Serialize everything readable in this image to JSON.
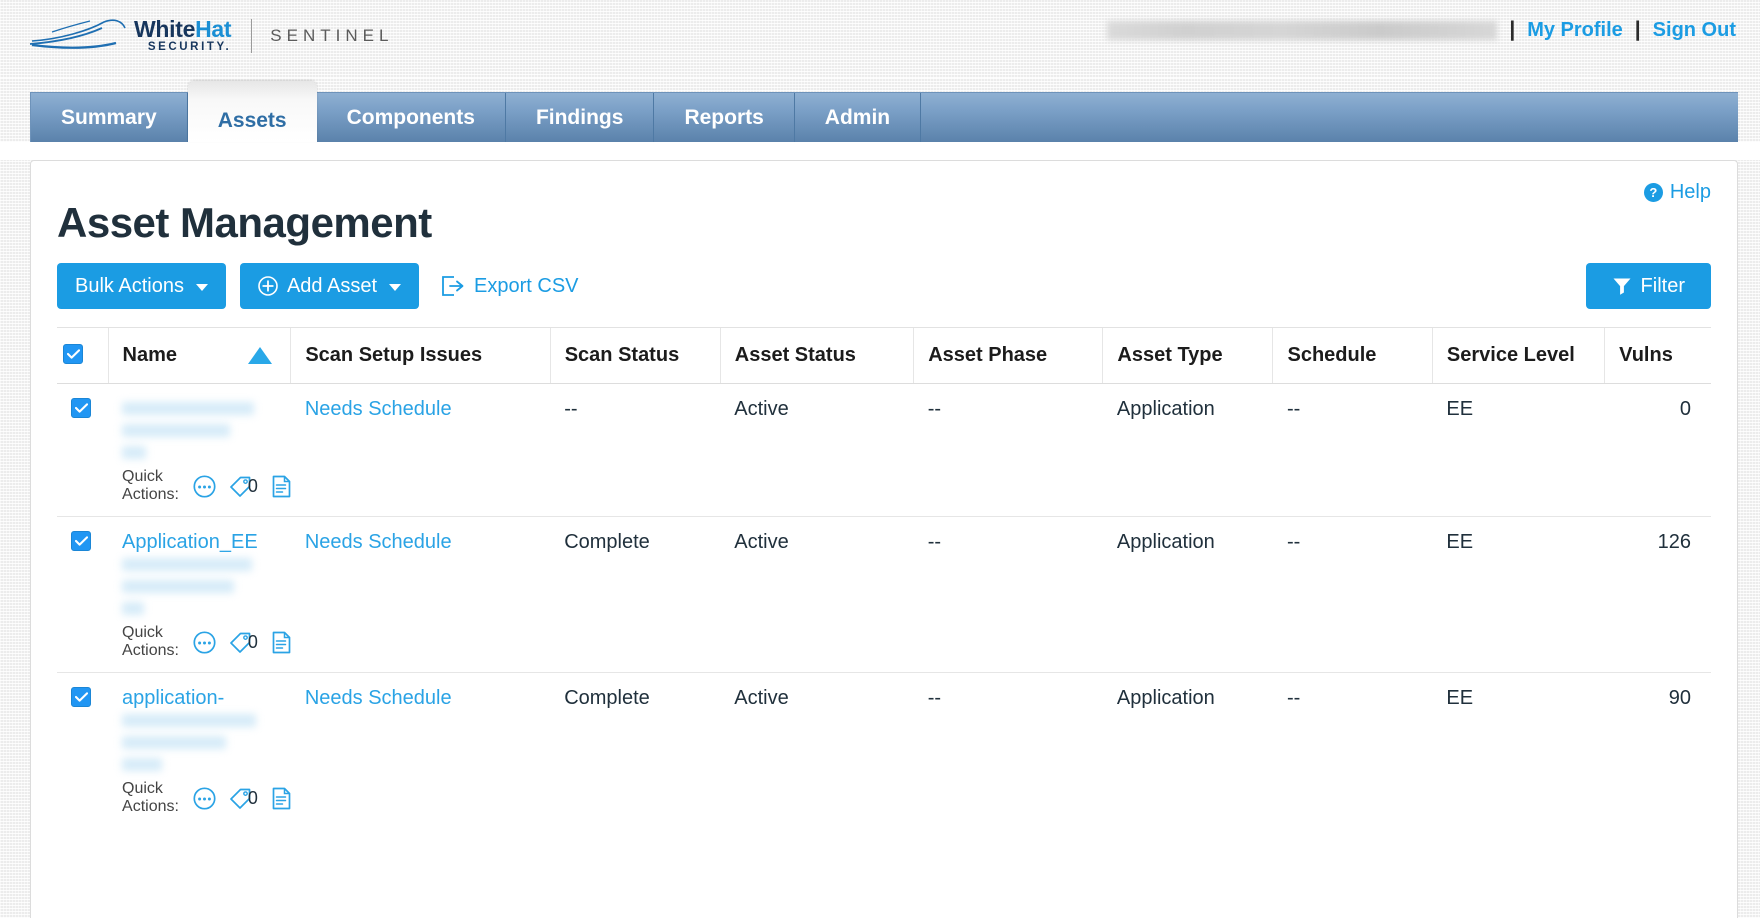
{
  "brand": {
    "name_white": "White",
    "name_hat": "Hat",
    "security": "SECURITY.",
    "product": "SENTINEL"
  },
  "header": {
    "user_account": "",
    "separator": "|",
    "my_profile": "My Profile",
    "sign_out": "Sign Out"
  },
  "nav": {
    "tabs": [
      {
        "label": "Summary",
        "active": false
      },
      {
        "label": "Assets",
        "active": true
      },
      {
        "label": "Components",
        "active": false
      },
      {
        "label": "Findings",
        "active": false
      },
      {
        "label": "Reports",
        "active": false
      },
      {
        "label": "Admin",
        "active": false
      }
    ]
  },
  "page": {
    "title": "Asset Management",
    "help_label": "Help",
    "help_badge": "?"
  },
  "toolbar": {
    "bulk_actions": "Bulk Actions",
    "add_asset": "Add Asset",
    "export_csv": "Export CSV",
    "filter": "Filter"
  },
  "table": {
    "columns": [
      "Name",
      "Scan Setup Issues",
      "Scan Status",
      "Asset Status",
      "Asset Phase",
      "Asset Type",
      "Schedule",
      "Service Level",
      "Vulns"
    ],
    "sort_column": "Name",
    "sort_direction": "asc",
    "quick_actions_label": "Quick Actions:",
    "rows": [
      {
        "checked": true,
        "name": "",
        "name_redacted": true,
        "scan_setup_issues": "Needs Schedule",
        "scan_status": "--",
        "asset_status": "Active",
        "asset_phase": "--",
        "asset_type": "Application",
        "schedule": "--",
        "service_level": "EE",
        "vulns": "0",
        "tag_count": "0"
      },
      {
        "checked": true,
        "name": "Application_EE",
        "name_redacted": true,
        "scan_setup_issues": "Needs Schedule",
        "scan_status": "Complete",
        "asset_status": "Active",
        "asset_phase": "--",
        "asset_type": "Application",
        "schedule": "--",
        "service_level": "EE",
        "vulns": "126",
        "tag_count": "0"
      },
      {
        "checked": true,
        "name": "application-",
        "name_redacted": true,
        "scan_setup_issues": "Needs Schedule",
        "scan_status": "Complete",
        "asset_status": "Active",
        "asset_phase": "--",
        "asset_type": "Application",
        "schedule": "--",
        "service_level": "EE",
        "vulns": "90",
        "tag_count": "0"
      }
    ]
  },
  "colors": {
    "accent_blue": "#1b9ce3",
    "link_blue": "#2aa3e5",
    "tab_blue": "#5b82ab",
    "brand_navy": "#17365d",
    "title_dark": "#20303c"
  }
}
